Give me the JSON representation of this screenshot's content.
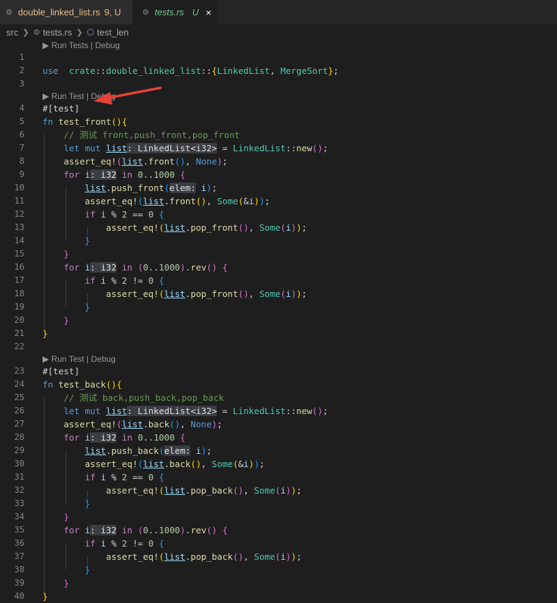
{
  "tabs": [
    {
      "icon": "rust-file-icon",
      "name": "double_linked_list.rs",
      "status": "9, U",
      "active": false
    },
    {
      "icon": "rust-file-icon",
      "name": "tests.rs",
      "status": "U",
      "active": true,
      "close": "×"
    }
  ],
  "breadcrumbs": {
    "root": "src",
    "file": "tests.rs",
    "symbol": "test_len"
  },
  "code_lenses": [
    "▶ Run Tests | Debug",
    "▶ Run Test | Debug",
    "▶ Run Test | Debug"
  ],
  "code_lines": [
    {
      "n": "1",
      "t": [],
      "lens": 0
    },
    {
      "n": "2",
      "t": [
        [
          "kw",
          "use"
        ],
        [
          "",
          "  "
        ],
        [
          "ty",
          "crate"
        ],
        [
          "",
          "::"
        ],
        [
          "ty",
          "double_linked_list"
        ],
        [
          "",
          "::"
        ],
        [
          "p1",
          "{"
        ],
        [
          "ty",
          "LinkedList"
        ],
        [
          "",
          ", "
        ],
        [
          "ty",
          "MergeSort"
        ],
        [
          "p1",
          "}"
        ],
        [
          "",
          ";"
        ]
      ]
    },
    {
      "n": "3",
      "t": []
    },
    {
      "n": "4",
      "t": [
        [
          "attr",
          "#[test]"
        ]
      ],
      "lens": 1
    },
    {
      "n": "5",
      "t": [
        [
          "kw",
          "fn"
        ],
        [
          "",
          " "
        ],
        [
          "fn",
          "test_front"
        ],
        [
          "p1",
          "()"
        ],
        [
          "p1",
          "{"
        ]
      ]
    },
    {
      "n": "6",
      "t": [
        [
          "",
          "    "
        ],
        [
          "com",
          "// 测试 front,push_front,pop_front"
        ]
      ]
    },
    {
      "n": "7",
      "t": [
        [
          "",
          "    "
        ],
        [
          "kw",
          "let"
        ],
        [
          "",
          " "
        ],
        [
          "kw",
          "mut"
        ],
        [
          "",
          " "
        ],
        [
          "mut",
          "list"
        ],
        [
          "hint",
          ": LinkedList<i32>"
        ],
        [
          "",
          " = "
        ],
        [
          "ty",
          "LinkedList"
        ],
        [
          "",
          "::"
        ],
        [
          "fn",
          "new"
        ],
        [
          "p2",
          "()"
        ],
        [
          "",
          ";"
        ]
      ]
    },
    {
      "n": "8",
      "t": [
        [
          "",
          "    "
        ],
        [
          "fn",
          "assert_eq!"
        ],
        [
          "p2",
          "("
        ],
        [
          "mut",
          "list"
        ],
        [
          "",
          "."
        ],
        [
          "fn",
          "front"
        ],
        [
          "p3",
          "()"
        ],
        [
          "",
          ", "
        ],
        [
          "kw",
          "None"
        ],
        [
          "p2",
          ")"
        ],
        [
          "",
          ";"
        ]
      ]
    },
    {
      "n": "9",
      "t": [
        [
          "",
          "    "
        ],
        [
          "ctl",
          "for"
        ],
        [
          "",
          " "
        ],
        [
          "var",
          "i"
        ],
        [
          "hint",
          ": i32"
        ],
        [
          "",
          " "
        ],
        [
          "ctl",
          "in"
        ],
        [
          "",
          " "
        ],
        [
          "num",
          "0"
        ],
        [
          "",
          ".."
        ],
        [
          "num",
          "1000"
        ],
        [
          "",
          " "
        ],
        [
          "p2",
          "{"
        ]
      ]
    },
    {
      "n": "10",
      "t": [
        [
          "",
          "        "
        ],
        [
          "mut",
          "list"
        ],
        [
          "",
          "."
        ],
        [
          "fn",
          "push_front"
        ],
        [
          "p3",
          "("
        ],
        [
          "hint",
          "elem:"
        ],
        [
          "",
          " "
        ],
        [
          "var",
          "i"
        ],
        [
          "p3",
          ")"
        ],
        [
          "",
          ";"
        ]
      ]
    },
    {
      "n": "11",
      "t": [
        [
          "",
          "        "
        ],
        [
          "fn",
          "assert_eq!"
        ],
        [
          "p3",
          "("
        ],
        [
          "mut",
          "list"
        ],
        [
          "",
          "."
        ],
        [
          "fn",
          "front"
        ],
        [
          "p1",
          "()"
        ],
        [
          "",
          ", "
        ],
        [
          "ty",
          "Some"
        ],
        [
          "p1",
          "("
        ],
        [
          "",
          "&"
        ],
        [
          "var",
          "i"
        ],
        [
          "p1",
          ")"
        ],
        [
          "p3",
          ")"
        ],
        [
          "",
          ";"
        ]
      ]
    },
    {
      "n": "12",
      "t": [
        [
          "",
          "        "
        ],
        [
          "ctl",
          "if"
        ],
        [
          "",
          " "
        ],
        [
          "var",
          "i"
        ],
        [
          "",
          " % "
        ],
        [
          "num",
          "2"
        ],
        [
          "",
          " == "
        ],
        [
          "num",
          "0"
        ],
        [
          "",
          " "
        ],
        [
          "p3",
          "{"
        ]
      ]
    },
    {
      "n": "13",
      "t": [
        [
          "",
          "            "
        ],
        [
          "fn",
          "assert_eq!"
        ],
        [
          "p1",
          "("
        ],
        [
          "mut",
          "list"
        ],
        [
          "",
          "."
        ],
        [
          "fn",
          "pop_front"
        ],
        [
          "p2",
          "()"
        ],
        [
          "",
          ", "
        ],
        [
          "ty",
          "Some"
        ],
        [
          "p2",
          "("
        ],
        [
          "var",
          "i"
        ],
        [
          "p2",
          ")"
        ],
        [
          "p1",
          ")"
        ],
        [
          "",
          ";"
        ]
      ]
    },
    {
      "n": "14",
      "t": [
        [
          "",
          "        "
        ],
        [
          "p3",
          "}"
        ]
      ]
    },
    {
      "n": "15",
      "t": [
        [
          "",
          "    "
        ],
        [
          "p2",
          "}"
        ]
      ]
    },
    {
      "n": "16",
      "t": [
        [
          "",
          "    "
        ],
        [
          "ctl",
          "for"
        ],
        [
          "",
          " "
        ],
        [
          "var",
          "i"
        ],
        [
          "hint",
          ": i32"
        ],
        [
          "",
          " "
        ],
        [
          "ctl",
          "in"
        ],
        [
          "",
          " "
        ],
        [
          "p2",
          "("
        ],
        [
          "num",
          "0"
        ],
        [
          "",
          ".."
        ],
        [
          "num",
          "1000"
        ],
        [
          "p2",
          ")"
        ],
        [
          "",
          "."
        ],
        [
          "fn",
          "rev"
        ],
        [
          "p2",
          "()"
        ],
        [
          "",
          " "
        ],
        [
          "p2",
          "{"
        ]
      ]
    },
    {
      "n": "17",
      "t": [
        [
          "",
          "        "
        ],
        [
          "ctl",
          "if"
        ],
        [
          "",
          " "
        ],
        [
          "var",
          "i"
        ],
        [
          "",
          " % "
        ],
        [
          "num",
          "2"
        ],
        [
          "",
          " != "
        ],
        [
          "num",
          "0"
        ],
        [
          "",
          " "
        ],
        [
          "p3",
          "{"
        ]
      ]
    },
    {
      "n": "18",
      "t": [
        [
          "",
          "            "
        ],
        [
          "fn",
          "assert_eq!"
        ],
        [
          "p1",
          "("
        ],
        [
          "mut",
          "list"
        ],
        [
          "",
          "."
        ],
        [
          "fn",
          "pop_front"
        ],
        [
          "p2",
          "()"
        ],
        [
          "",
          ", "
        ],
        [
          "ty",
          "Some"
        ],
        [
          "p2",
          "("
        ],
        [
          "var",
          "i"
        ],
        [
          "p2",
          ")"
        ],
        [
          "p1",
          ")"
        ],
        [
          "",
          ";"
        ]
      ]
    },
    {
      "n": "19",
      "t": [
        [
          "",
          "        "
        ],
        [
          "p3",
          "}"
        ]
      ]
    },
    {
      "n": "20",
      "t": [
        [
          "",
          "    "
        ],
        [
          "p2",
          "}"
        ]
      ]
    },
    {
      "n": "21",
      "t": [
        [
          "p1",
          "}"
        ]
      ]
    },
    {
      "n": "22",
      "t": []
    },
    {
      "n": "23",
      "t": [
        [
          "attr",
          "#[test]"
        ]
      ],
      "lens": 2
    },
    {
      "n": "24",
      "t": [
        [
          "kw",
          "fn"
        ],
        [
          "",
          " "
        ],
        [
          "fn",
          "test_back"
        ],
        [
          "p1",
          "()"
        ],
        [
          "p1",
          "{"
        ]
      ]
    },
    {
      "n": "25",
      "t": [
        [
          "",
          "    "
        ],
        [
          "com",
          "// 测试 back,push_back,pop_back"
        ]
      ]
    },
    {
      "n": "26",
      "t": [
        [
          "",
          "    "
        ],
        [
          "kw",
          "let"
        ],
        [
          "",
          " "
        ],
        [
          "kw",
          "mut"
        ],
        [
          "",
          " "
        ],
        [
          "mut",
          "list"
        ],
        [
          "hint",
          ": LinkedList<i32>"
        ],
        [
          "",
          " = "
        ],
        [
          "ty",
          "LinkedList"
        ],
        [
          "",
          "::"
        ],
        [
          "fn",
          "new"
        ],
        [
          "p2",
          "()"
        ],
        [
          "",
          ";"
        ]
      ]
    },
    {
      "n": "27",
      "t": [
        [
          "",
          "    "
        ],
        [
          "fn",
          "assert_eq!"
        ],
        [
          "p2",
          "("
        ],
        [
          "mut",
          "list"
        ],
        [
          "",
          "."
        ],
        [
          "fn",
          "back"
        ],
        [
          "p3",
          "()"
        ],
        [
          "",
          ", "
        ],
        [
          "kw",
          "None"
        ],
        [
          "p2",
          ")"
        ],
        [
          "",
          ";"
        ]
      ]
    },
    {
      "n": "28",
      "t": [
        [
          "",
          "    "
        ],
        [
          "ctl",
          "for"
        ],
        [
          "",
          " "
        ],
        [
          "var",
          "i"
        ],
        [
          "hint",
          ": i32"
        ],
        [
          "",
          " "
        ],
        [
          "ctl",
          "in"
        ],
        [
          "",
          " "
        ],
        [
          "num",
          "0"
        ],
        [
          "",
          ".."
        ],
        [
          "num",
          "1000"
        ],
        [
          "",
          " "
        ],
        [
          "p2",
          "{"
        ]
      ]
    },
    {
      "n": "29",
      "t": [
        [
          "",
          "        "
        ],
        [
          "mut",
          "list"
        ],
        [
          "",
          "."
        ],
        [
          "fn",
          "push_back"
        ],
        [
          "p3",
          "("
        ],
        [
          "hint",
          "elem:"
        ],
        [
          "",
          " "
        ],
        [
          "var",
          "i"
        ],
        [
          "p3",
          ")"
        ],
        [
          "",
          ";"
        ]
      ]
    },
    {
      "n": "30",
      "t": [
        [
          "",
          "        "
        ],
        [
          "fn",
          "assert_eq!"
        ],
        [
          "p3",
          "("
        ],
        [
          "mut",
          "list"
        ],
        [
          "",
          "."
        ],
        [
          "fn",
          "back"
        ],
        [
          "p1",
          "()"
        ],
        [
          "",
          ", "
        ],
        [
          "ty",
          "Some"
        ],
        [
          "p1",
          "("
        ],
        [
          "",
          "&"
        ],
        [
          "var",
          "i"
        ],
        [
          "p1",
          ")"
        ],
        [
          "p3",
          ")"
        ],
        [
          "",
          ";"
        ]
      ]
    },
    {
      "n": "31",
      "t": [
        [
          "",
          "        "
        ],
        [
          "ctl",
          "if"
        ],
        [
          "",
          " "
        ],
        [
          "var",
          "i"
        ],
        [
          "",
          " % "
        ],
        [
          "num",
          "2"
        ],
        [
          "",
          " == "
        ],
        [
          "num",
          "0"
        ],
        [
          "",
          " "
        ],
        [
          "p3",
          "{"
        ]
      ]
    },
    {
      "n": "32",
      "t": [
        [
          "",
          "            "
        ],
        [
          "fn",
          "assert_eq!"
        ],
        [
          "p1",
          "("
        ],
        [
          "mut",
          "list"
        ],
        [
          "",
          "."
        ],
        [
          "fn",
          "pop_back"
        ],
        [
          "p2",
          "()"
        ],
        [
          "",
          ", "
        ],
        [
          "ty",
          "Some"
        ],
        [
          "p2",
          "("
        ],
        [
          "var",
          "i"
        ],
        [
          "p2",
          ")"
        ],
        [
          "p1",
          ")"
        ],
        [
          "",
          ";"
        ]
      ]
    },
    {
      "n": "33",
      "t": [
        [
          "",
          "        "
        ],
        [
          "p3",
          "}"
        ]
      ]
    },
    {
      "n": "34",
      "t": [
        [
          "",
          "    "
        ],
        [
          "p2",
          "}"
        ]
      ]
    },
    {
      "n": "35",
      "t": [
        [
          "",
          "    "
        ],
        [
          "ctl",
          "for"
        ],
        [
          "",
          " "
        ],
        [
          "var",
          "i"
        ],
        [
          "hint",
          ": i32"
        ],
        [
          "",
          " "
        ],
        [
          "ctl",
          "in"
        ],
        [
          "",
          " "
        ],
        [
          "p2",
          "("
        ],
        [
          "num",
          "0"
        ],
        [
          "",
          ".."
        ],
        [
          "num",
          "1000"
        ],
        [
          "p2",
          ")"
        ],
        [
          "",
          "."
        ],
        [
          "fn",
          "rev"
        ],
        [
          "p2",
          "()"
        ],
        [
          "",
          " "
        ],
        [
          "p2",
          "{"
        ]
      ]
    },
    {
      "n": "36",
      "t": [
        [
          "",
          "        "
        ],
        [
          "ctl",
          "if"
        ],
        [
          "",
          " "
        ],
        [
          "var",
          "i"
        ],
        [
          "",
          " % "
        ],
        [
          "num",
          "2"
        ],
        [
          "",
          " != "
        ],
        [
          "num",
          "0"
        ],
        [
          "",
          " "
        ],
        [
          "p3",
          "{"
        ]
      ]
    },
    {
      "n": "37",
      "t": [
        [
          "",
          "            "
        ],
        [
          "fn",
          "assert_eq!"
        ],
        [
          "p1",
          "("
        ],
        [
          "mut",
          "list"
        ],
        [
          "",
          "."
        ],
        [
          "fn",
          "pop_back"
        ],
        [
          "p2",
          "()"
        ],
        [
          "",
          ", "
        ],
        [
          "ty",
          "Some"
        ],
        [
          "p2",
          "("
        ],
        [
          "var",
          "i"
        ],
        [
          "p2",
          ")"
        ],
        [
          "p1",
          ")"
        ],
        [
          "",
          ";"
        ]
      ]
    },
    {
      "n": "38",
      "t": [
        [
          "",
          "        "
        ],
        [
          "p3",
          "}"
        ]
      ]
    },
    {
      "n": "39",
      "t": [
        [
          "",
          "    "
        ],
        [
          "p2",
          "}"
        ]
      ]
    },
    {
      "n": "40",
      "t": [
        [
          "p1",
          "}"
        ]
      ]
    }
  ],
  "annotation": {
    "icon": "red-arrow-annotation",
    "color": "#e8413a"
  }
}
